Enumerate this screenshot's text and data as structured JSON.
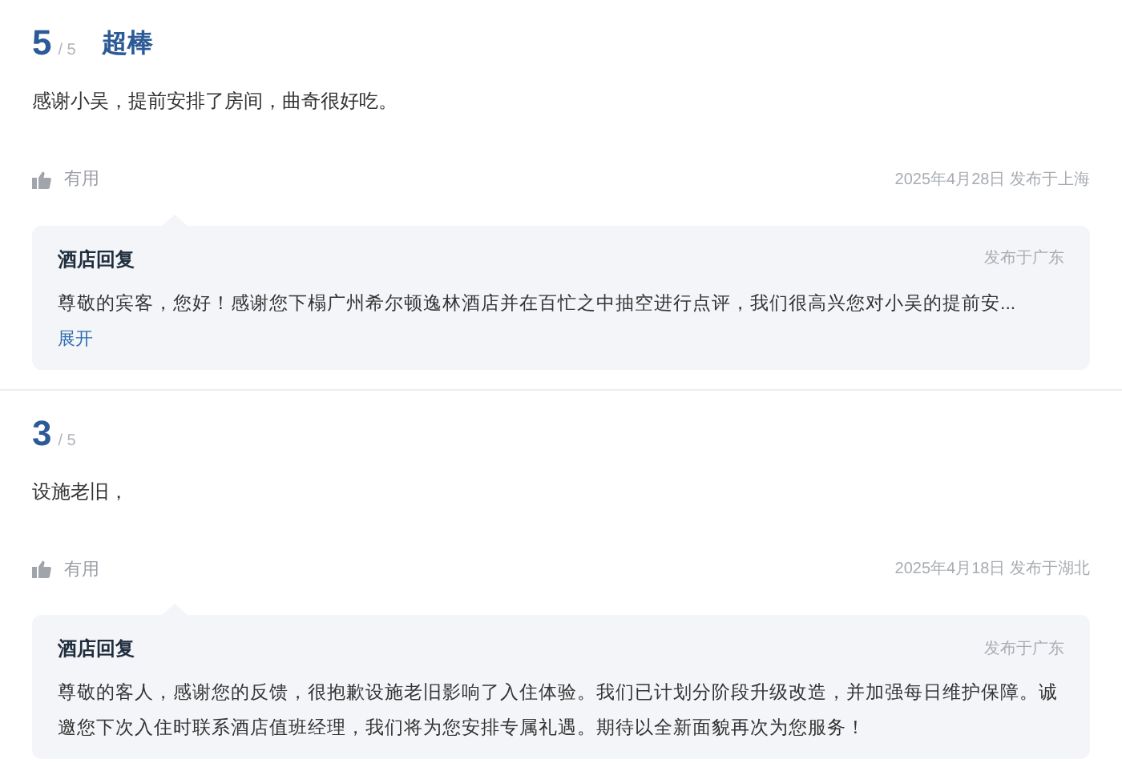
{
  "reviews": [
    {
      "score": "5",
      "max": "/ 5",
      "rating_label": "超棒",
      "text": "感谢小吴，提前安排了房间，曲奇很好吃。",
      "helpful": "有用",
      "meta": "2025年4月28日 发布于上海",
      "reply": {
        "title": "酒店回复",
        "location": "发布于广东",
        "text": "尊敬的宾客，您好！感谢您下榻广州希尔顿逸林酒店并在百忙之中抽空进行点评，我们很高兴您对小吴的提前安...",
        "expand": "展开"
      }
    },
    {
      "score": "3",
      "max": "/ 5",
      "text": "设施老旧，",
      "helpful": "有用",
      "meta": "2025年4月18日 发布于湖北",
      "reply": {
        "title": "酒店回复",
        "location": "发布于广东",
        "text": "尊敬的客人，感谢您的反馈，很抱歉设施老旧影响了入住体验。我们已计划分阶段升级改造，并加强每日维护保障。诚邀您下次入住时联系酒店值班经理，我们将为您安排专属礼遇。期待以全新面貌再次为您服务！"
      }
    }
  ]
}
